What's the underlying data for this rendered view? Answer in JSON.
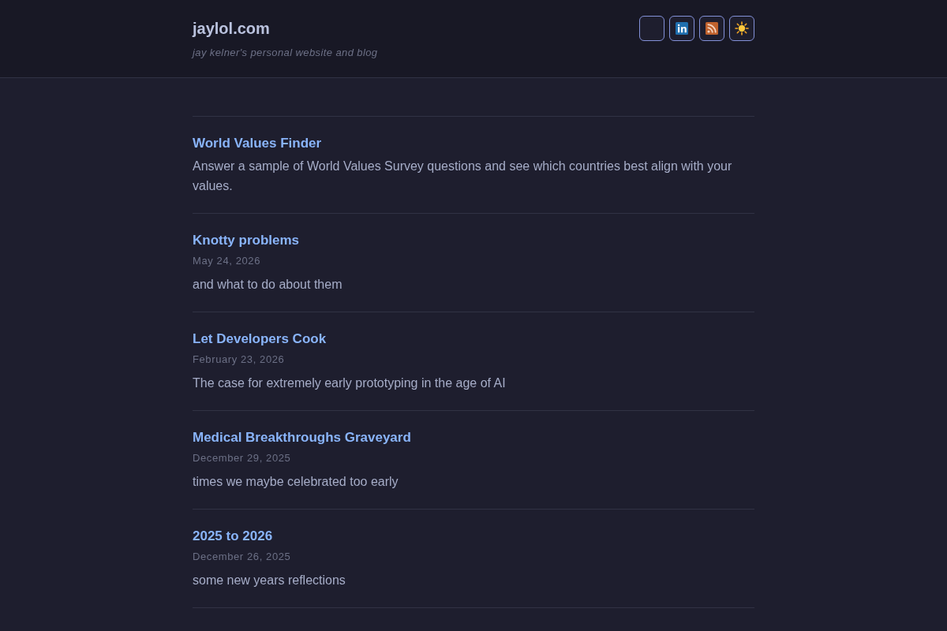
{
  "header": {
    "site_title": "jaylol.com",
    "tagline": "jay kelner's personal website and blog",
    "buttons": [
      {
        "kind": "blank"
      },
      {
        "kind": "linkedin"
      },
      {
        "kind": "rss"
      },
      {
        "kind": "theme"
      }
    ]
  },
  "posts": [
    {
      "title": "World Values Finder",
      "description": "Answer a sample of World Values Survey questions and see which countries best align with your values."
    },
    {
      "title": "Knotty problems",
      "date": "May 24, 2026",
      "description": "and what to do about them"
    },
    {
      "title": "Let Developers Cook",
      "date": "February 23, 2026",
      "description": "The case for extremely early prototyping in the age of AI"
    },
    {
      "title": "Medical Breakthroughs Graveyard",
      "date": "December 29, 2025",
      "description": "times we maybe celebrated too early"
    },
    {
      "title": "2025 to 2026",
      "date": "December 26, 2025",
      "description": "some new years reflections"
    }
  ]
}
